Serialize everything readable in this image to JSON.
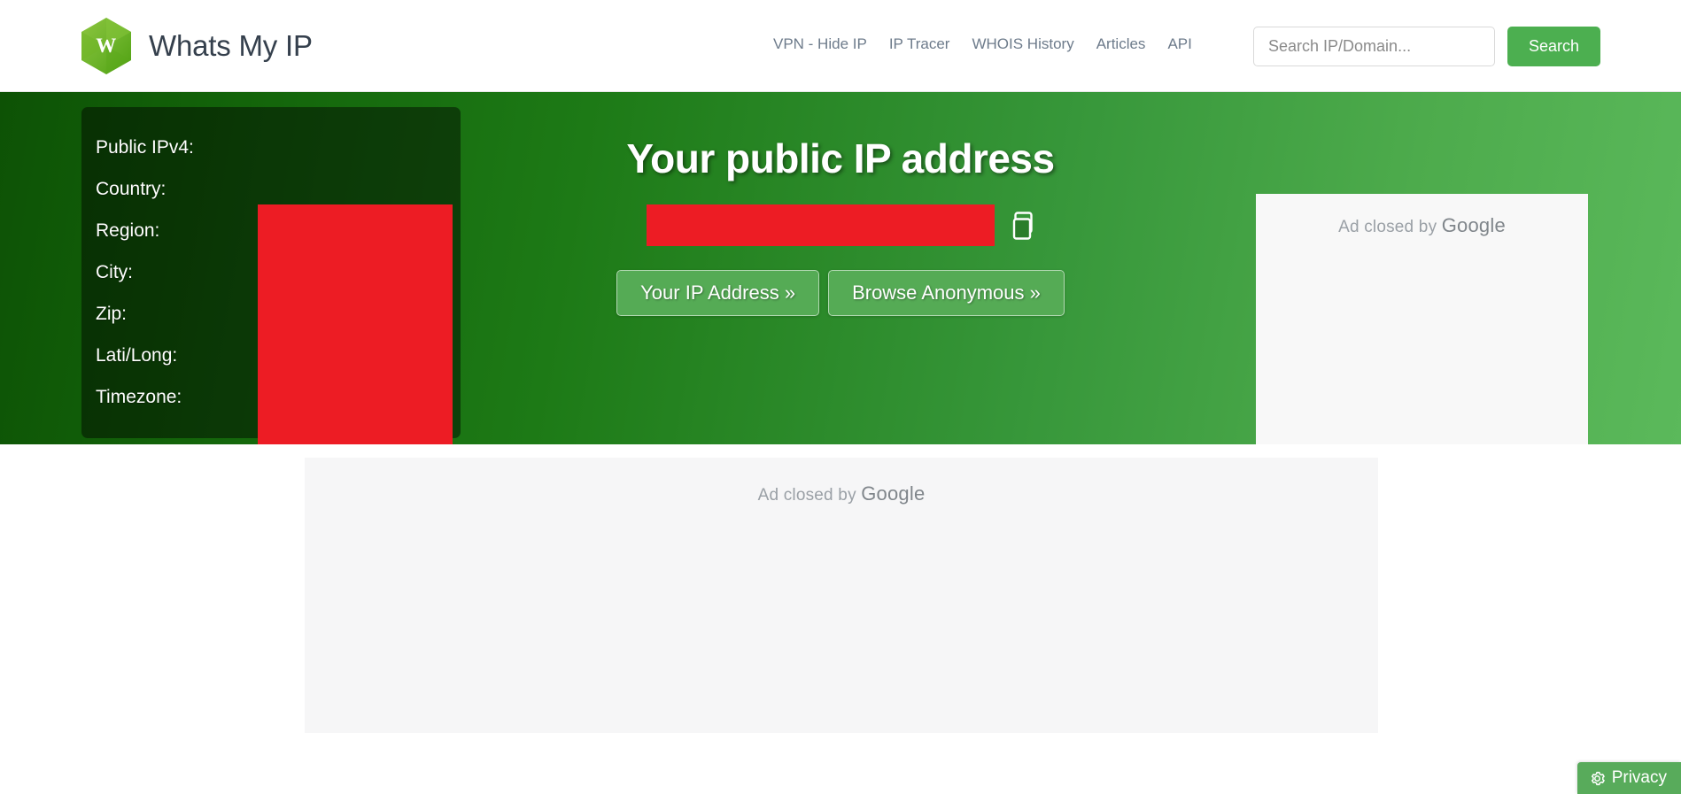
{
  "header": {
    "brand_title": "Whats My IP",
    "logo_letter": "W",
    "nav": [
      {
        "label": "VPN - Hide IP"
      },
      {
        "label": "IP Tracer"
      },
      {
        "label": "WHOIS History"
      },
      {
        "label": "Articles"
      },
      {
        "label": "API"
      }
    ],
    "search": {
      "placeholder": "Search IP/Domain...",
      "value": "",
      "button_label": "Search"
    }
  },
  "hero": {
    "title": "Your public IP address",
    "ip_value": "",
    "copy_icon": "copy-icon",
    "buttons": [
      {
        "label": "Your IP Address »"
      },
      {
        "label": "Browse Anonymous »"
      }
    ],
    "info_panel": {
      "rows": [
        {
          "label": "Public IPv4:",
          "value": ""
        },
        {
          "label": "Country:",
          "value": ""
        },
        {
          "label": "Region:",
          "value": ""
        },
        {
          "label": "City:",
          "value": ""
        },
        {
          "label": "Zip:",
          "value": ""
        },
        {
          "label": "Lati/Long:",
          "value": ""
        },
        {
          "label": "Timezone:",
          "value": ""
        }
      ]
    }
  },
  "ads": {
    "hero_ad": {
      "prefix": "Ad closed by ",
      "brand": "Google"
    },
    "body_ad": {
      "prefix": "Ad closed by ",
      "brand": "Google"
    }
  },
  "privacy_badge": {
    "label": "Privacy",
    "icon": "gear-icon"
  },
  "colors": {
    "brand_green": "#4CAF50",
    "hero_gradient_start": "#0d5205",
    "hero_gradient_end": "#5bb95b",
    "redaction_red": "#ED1C24",
    "nav_text": "#6d7b8b",
    "brand_text": "#35404d",
    "ad_text": "#9aa0a6"
  }
}
